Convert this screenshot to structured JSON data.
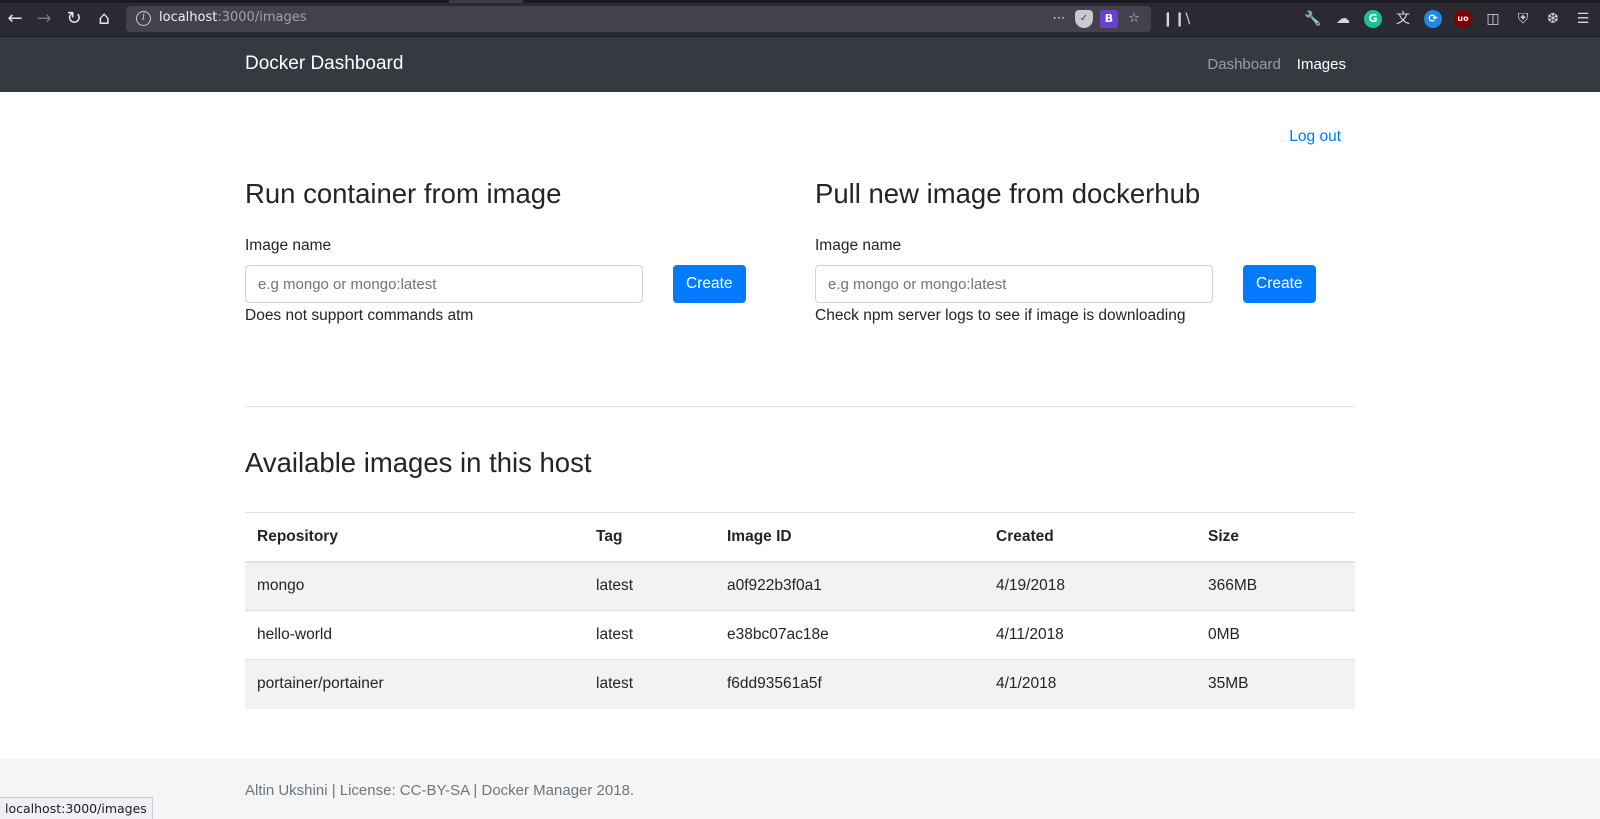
{
  "browser": {
    "url_host": "localhost",
    "url_path": ":3000/images",
    "status_url": "localhost:3000/images",
    "accent_extension_b": "#6b3fd3"
  },
  "navbar": {
    "brand": "Docker Dashboard",
    "links": [
      {
        "label": "Dashboard",
        "active": false
      },
      {
        "label": "Images",
        "active": true
      }
    ],
    "background": "#343a40"
  },
  "auth": {
    "logout_label": "Log out"
  },
  "run_form": {
    "title": "Run container from image",
    "label": "Image name",
    "placeholder": "e.g mongo or mongo:latest",
    "value": "",
    "button_label": "Create",
    "help": "Does not support commands atm"
  },
  "pull_form": {
    "title": "Pull new image from dockerhub",
    "label": "Image name",
    "placeholder": "e.g mongo or mongo:latest",
    "value": "",
    "button_label": "Create",
    "help": "Check npm server logs to see if image is downloading"
  },
  "images_section": {
    "title": "Available images in this host",
    "columns": [
      "Repository",
      "Tag",
      "Image ID",
      "Created",
      "Size"
    ],
    "rows": [
      {
        "repository": "mongo",
        "tag": "latest",
        "image_id": "a0f922b3f0a1",
        "created": "4/19/2018",
        "size": "366MB"
      },
      {
        "repository": "hello-world",
        "tag": "latest",
        "image_id": "e38bc07ac18e",
        "created": "4/11/2018",
        "size": "0MB"
      },
      {
        "repository": "portainer/portainer",
        "tag": "latest",
        "image_id": "f6dd93561a5f",
        "created": "4/1/2018",
        "size": "35MB"
      }
    ]
  },
  "footer": {
    "text": "Altin Ukshini | License: CC-BY-SA | Docker Manager 2018."
  },
  "colors": {
    "primary": "#007bff",
    "footer_bg": "#f5f5f5"
  }
}
